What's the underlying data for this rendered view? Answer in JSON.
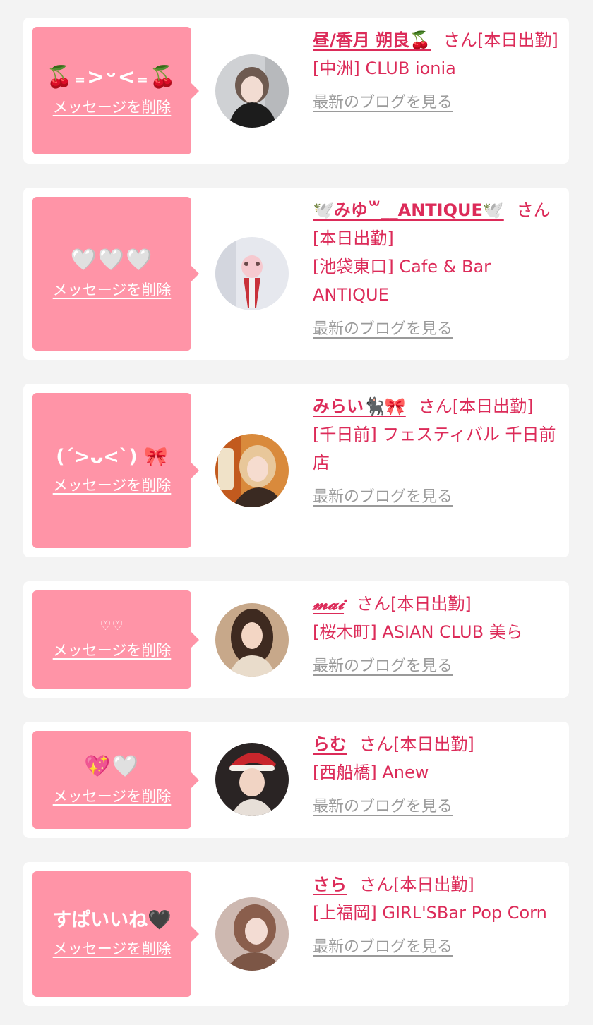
{
  "colors": {
    "page_background": "#f3f3f3",
    "card_background": "#ffffff",
    "bubble_pink": "#ff94a7",
    "accent_text": "#dc2b59",
    "blog_link_gray": "#9a9a9a"
  },
  "cards": [
    {
      "message": "🍒₌>ᵕ<₌🍒",
      "delete_label": "メッセージを削除",
      "name": "昼/香月 朔良🍒",
      "suffix": "さん[本日出勤]",
      "shop": "[中洲] CLUB ionia",
      "blog_label": "最新のブログを見る"
    },
    {
      "message": "🤍🤍🤍",
      "delete_label": "メッセージを削除",
      "name": "🕊️みゆ꒳__ANTIQUE🕊️",
      "suffix": "さん[本日出勤]",
      "shop": "[池袋東口] Cafe & Bar ANTIQUE",
      "blog_label": "最新のブログを見る"
    },
    {
      "message": "(ˊ>ᴗ<ˋ) 🎀",
      "delete_label": "メッセージを削除",
      "name": "みらい🐈‍⬛🎀",
      "suffix": "さん[本日出勤]",
      "shop": "[千日前] フェスティバル 千日前店",
      "blog_label": "最新のブログを見る"
    },
    {
      "message": "♡♡",
      "delete_label": "メッセージを削除",
      "name": "𝓶𝓪𝓲",
      "suffix": "さん[本日出勤]",
      "shop": "[桜木町] ASIAN CLUB 美ら",
      "blog_label": "最新のブログを見る"
    },
    {
      "message": "💖🤍",
      "delete_label": "メッセージを削除",
      "name": "らむ",
      "suffix": "さん[本日出勤]",
      "shop": "[西船橋] Anew",
      "blog_label": "最新のブログを見る"
    },
    {
      "message": "すぱいいね🖤",
      "delete_label": "メッセージを削除",
      "name": "さら",
      "suffix": "さん[本日出勤]",
      "shop": "[上福岡] GIRL'SBar Pop Corn",
      "blog_label": "最新のブログを見る"
    }
  ]
}
